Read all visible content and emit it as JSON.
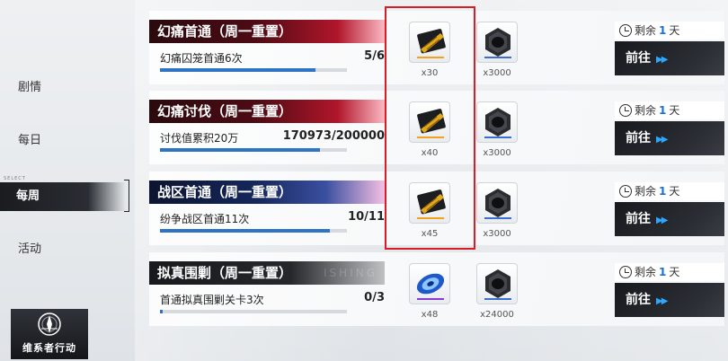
{
  "sidebar": {
    "select_tag": "SELECT",
    "items": [
      {
        "label": "剧情",
        "active": false
      },
      {
        "label": "每日",
        "active": false
      },
      {
        "label": "每周",
        "active": true
      },
      {
        "label": "活动",
        "active": false
      }
    ],
    "logo_text": "维系者行动"
  },
  "tasks": [
    {
      "title": "幻痛首通（周一重置）",
      "banner_deco": "",
      "description": "幻痛囚笼首通6次",
      "progress_text": "5/6",
      "progress_fraction": 0.8333,
      "rewards": [
        {
          "icon": "gold-ticket-icon",
          "qty": "x30"
        },
        {
          "icon": "hex-nut-icon",
          "qty": "x3000"
        }
      ],
      "timer": {
        "prefix": "剩余",
        "value": "1",
        "suffix": "天"
      },
      "go_label": "前往"
    },
    {
      "title": "幻痛讨伐（周一重置）",
      "banner_deco": "",
      "description": "讨伐值累积20万",
      "progress_text": "170973/200000",
      "progress_fraction": 0.8549,
      "rewards": [
        {
          "icon": "gold-ticket-icon",
          "qty": "x40"
        },
        {
          "icon": "hex-nut-icon",
          "qty": "x3000"
        }
      ],
      "timer": {
        "prefix": "剩余",
        "value": "1",
        "suffix": "天"
      },
      "go_label": "前往"
    },
    {
      "title": "战区首通（周一重置）",
      "banner_deco": "",
      "description": "纷争战区首通11次",
      "progress_text": "10/11",
      "progress_fraction": 0.9091,
      "rewards": [
        {
          "icon": "gold-ticket-icon",
          "qty": "x45"
        },
        {
          "icon": "hex-nut-icon",
          "qty": "x3000"
        }
      ],
      "timer": {
        "prefix": "剩余",
        "value": "1",
        "suffix": "天"
      },
      "go_label": "前往"
    },
    {
      "title": "拟真围剿（周一重置）",
      "banner_deco": "ISHING",
      "description": "首通拟真围剿关卡3次",
      "progress_text": "0/3",
      "progress_fraction": 0.0,
      "rewards": [
        {
          "icon": "blue-disc-icon",
          "qty": "x48"
        },
        {
          "icon": "hex-nut-icon",
          "qty": "x24000"
        }
      ],
      "timer": {
        "prefix": "剩余",
        "value": "1",
        "suffix": "天"
      },
      "go_label": "前往"
    }
  ],
  "colors": {
    "accent_blue": "#2f73c4",
    "highlight_red": "#d81e24",
    "timer_number": "#1d6fd0"
  }
}
